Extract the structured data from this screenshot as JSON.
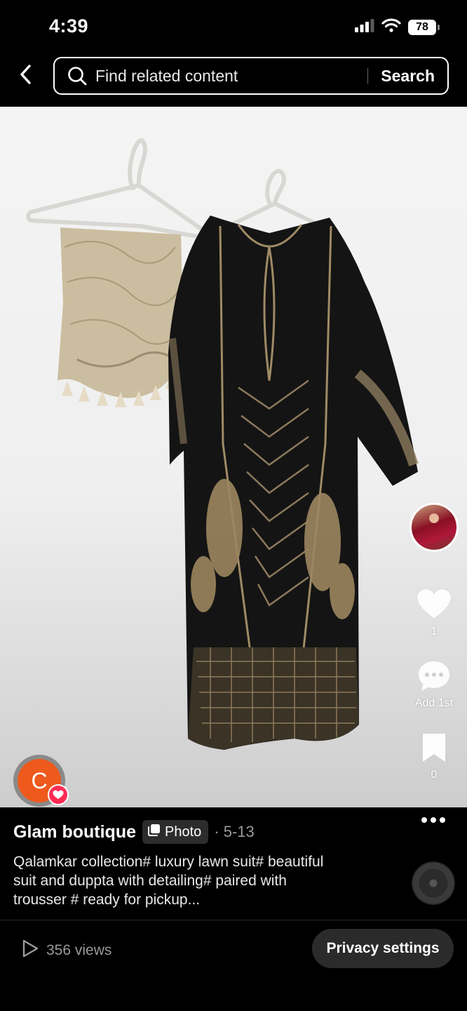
{
  "status_bar": {
    "time": "4:39",
    "battery": "78"
  },
  "search": {
    "placeholder": "Find related content",
    "button_label": "Search"
  },
  "rail": {
    "likes": "1",
    "comments_label": "Add 1st",
    "saves": "0"
  },
  "author": {
    "avatar_letter": "C",
    "name": "Glam boutique",
    "tag_label": "Photo",
    "date": "· 5-13"
  },
  "caption": "Qalamkar collection# luxury lawn suit# beautiful suit and duppta with detailing# paired with trousser # ready for pickup...",
  "footer": {
    "views": "356 views",
    "privacy_label": "Privacy settings"
  },
  "colors": {
    "accent": "#ff2b55",
    "avatar_bg": "#ee5a1c",
    "dress": "#141414",
    "embroidery": "#a08a66",
    "dupatta": "#cbbd9f"
  }
}
